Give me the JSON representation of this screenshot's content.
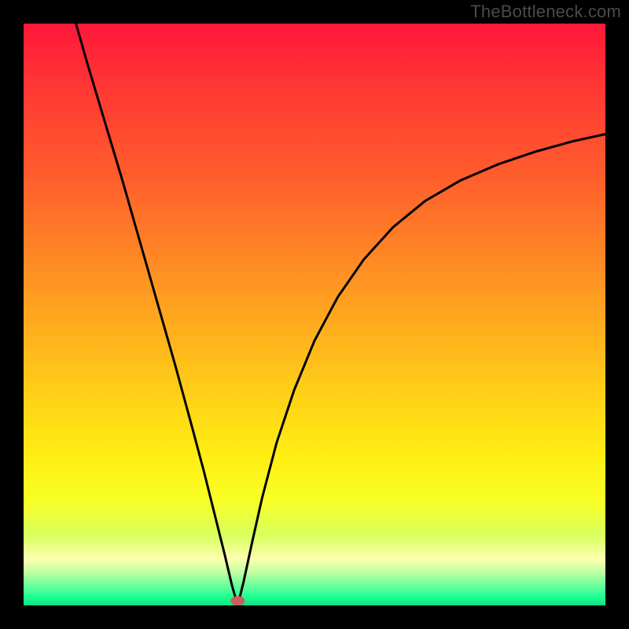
{
  "watermark": "TheBottleneck.com",
  "chart_data": {
    "type": "line",
    "title": "",
    "xlabel": "",
    "ylabel": "",
    "xlim": [
      0,
      1
    ],
    "ylim": [
      0,
      1
    ],
    "grid": false,
    "legend": false,
    "notch": {
      "x": 0.368,
      "y": 0.0
    },
    "marker": {
      "x": 0.368,
      "y": 0.008,
      "color": "#cd5c5c"
    },
    "gradient_stops": [
      {
        "offset": 0.0,
        "color": "#ff173a"
      },
      {
        "offset": 0.12,
        "color": "#ff3a33"
      },
      {
        "offset": 0.25,
        "color": "#ff5a2d"
      },
      {
        "offset": 0.38,
        "color": "#ff8126"
      },
      {
        "offset": 0.5,
        "color": "#ffa61f"
      },
      {
        "offset": 0.62,
        "color": "#ffcb18"
      },
      {
        "offset": 0.74,
        "color": "#ffed12"
      },
      {
        "offset": 0.82,
        "color": "#f8ff26"
      },
      {
        "offset": 0.88,
        "color": "#d8ff5e"
      },
      {
        "offset": 0.92,
        "color": "#fdffb0"
      },
      {
        "offset": 0.945,
        "color": "#b8ffa0"
      },
      {
        "offset": 0.965,
        "color": "#6cff9c"
      },
      {
        "offset": 0.985,
        "color": "#1fff92"
      },
      {
        "offset": 1.0,
        "color": "#0be383"
      }
    ],
    "series": [
      {
        "name": "curve",
        "points": [
          {
            "x": 0.09,
            "y": 1.0
          },
          {
            "x": 0.11,
            "y": 0.93
          },
          {
            "x": 0.14,
            "y": 0.83
          },
          {
            "x": 0.17,
            "y": 0.73
          },
          {
            "x": 0.2,
            "y": 0.625
          },
          {
            "x": 0.23,
            "y": 0.52
          },
          {
            "x": 0.26,
            "y": 0.415
          },
          {
            "x": 0.29,
            "y": 0.305
          },
          {
            "x": 0.31,
            "y": 0.23
          },
          {
            "x": 0.33,
            "y": 0.15
          },
          {
            "x": 0.345,
            "y": 0.09
          },
          {
            "x": 0.358,
            "y": 0.035
          },
          {
            "x": 0.368,
            "y": 0.0
          },
          {
            "x": 0.378,
            "y": 0.04
          },
          {
            "x": 0.392,
            "y": 0.105
          },
          {
            "x": 0.41,
            "y": 0.185
          },
          {
            "x": 0.435,
            "y": 0.28
          },
          {
            "x": 0.465,
            "y": 0.37
          },
          {
            "x": 0.5,
            "y": 0.455
          },
          {
            "x": 0.54,
            "y": 0.53
          },
          {
            "x": 0.585,
            "y": 0.595
          },
          {
            "x": 0.635,
            "y": 0.65
          },
          {
            "x": 0.69,
            "y": 0.695
          },
          {
            "x": 0.75,
            "y": 0.73
          },
          {
            "x": 0.815,
            "y": 0.758
          },
          {
            "x": 0.88,
            "y": 0.78
          },
          {
            "x": 0.945,
            "y": 0.798
          },
          {
            "x": 1.0,
            "y": 0.81
          }
        ]
      }
    ]
  }
}
